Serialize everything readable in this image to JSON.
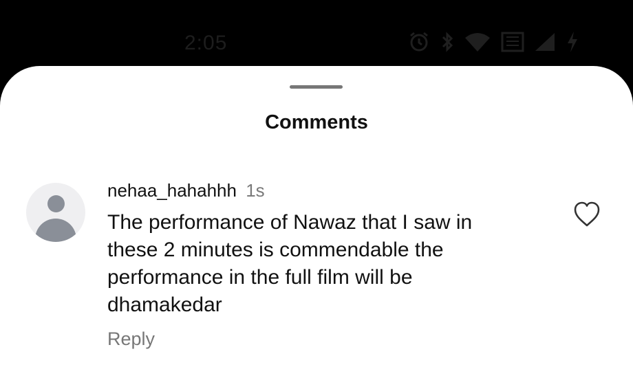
{
  "status_bar": {
    "time": "2:05",
    "icons": [
      "alarm-icon",
      "bluetooth-icon",
      "wifi-icon",
      "battery-saver-icon",
      "signal-icon",
      "charging-icon"
    ]
  },
  "sheet": {
    "title": "Comments"
  },
  "comment": {
    "username": "nehaa_hahahhh",
    "time": "1s",
    "text": "The performance of Nawaz that I saw in these 2 minutes is commendable the performance in the full film will be dhamakedar",
    "reply_label": "Reply"
  },
  "colors": {
    "background": "#000000",
    "sheet": "#ffffff",
    "text": "#111111",
    "secondary_text": "#777777",
    "avatar_bg": "#efeff1",
    "avatar_fg": "#8a8f98"
  }
}
